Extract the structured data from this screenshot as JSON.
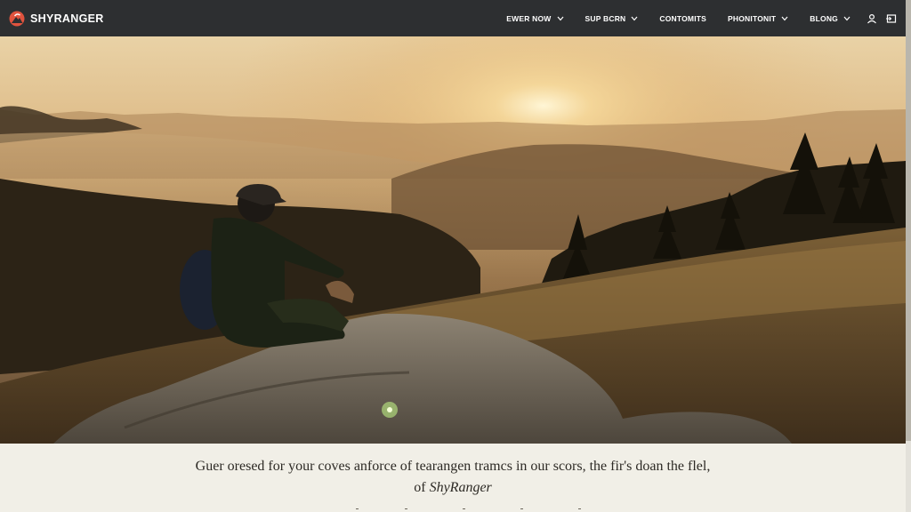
{
  "header": {
    "brand": "SHYRANGER",
    "nav": [
      {
        "label": "EWER NOW",
        "has_dropdown": true
      },
      {
        "label": "SUP BCRN",
        "has_dropdown": true
      },
      {
        "label": "CONTOMITS",
        "has_dropdown": false
      },
      {
        "label": "PHONITONIT",
        "has_dropdown": true
      },
      {
        "label": "BLONG",
        "has_dropdown": true
      }
    ],
    "icons": [
      "user-icon",
      "login-icon"
    ]
  },
  "hero": {
    "image": "hiker-sunrise-mountain-photo"
  },
  "caption": {
    "line1": "Guer oresed for your coves anforce of tearangen tramcs in our scors, the fir's doan the flel,",
    "line2_prefix": "of ",
    "line2_brand": "ShyRanger"
  },
  "colors": {
    "nav_bg": "#2d2f31",
    "brand_accent": "#e0533e",
    "caption_bg": "#f1efe7"
  }
}
